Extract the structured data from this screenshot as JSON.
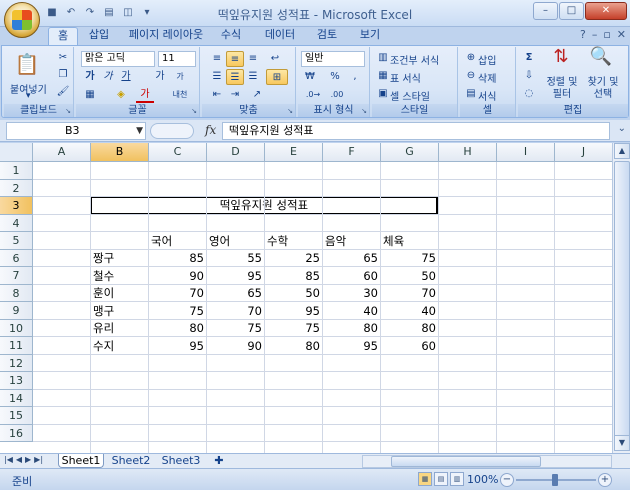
{
  "window": {
    "title": "떡잎유지원 성적표 - Microsoft Excel"
  },
  "ribbon": {
    "tabs": [
      "홈",
      "삽입",
      "페이지 레이아웃",
      "수식",
      "데이터",
      "검토",
      "보기"
    ],
    "active_tab": "홈",
    "clipboard": {
      "paste": "붙여넣기",
      "label": "클립보드"
    },
    "font": {
      "name": "맑은 고딕",
      "size": "11",
      "label": "글꼴",
      "bold": "가",
      "italic": "가",
      "underline": "가",
      "grow": "가",
      "shrink": "가",
      "color_letter": "가",
      "phonetic": "내천"
    },
    "alignment": {
      "label": "맞춤"
    },
    "number": {
      "format": "일반",
      "currency": "₩",
      "percent": "%",
      "comma": ",",
      "label": "표시 형식"
    },
    "styles": {
      "conditional": "조건부 서식",
      "table": "표 서식",
      "cell": "셀 스타일",
      "label": "스타일"
    },
    "cells": {
      "insert": "삽입",
      "delete": "삭제",
      "format": "서식",
      "label": "셀"
    },
    "editing": {
      "sum": "Σ",
      "sort": "정렬 및 필터",
      "find": "찾기 및 선택",
      "label": "편집"
    }
  },
  "formula_bar": {
    "name_box": "B3",
    "fx": "fx",
    "value": "떡잎유지원 성적표"
  },
  "sheet": {
    "columns": [
      "A",
      "B",
      "C",
      "D",
      "E",
      "F",
      "G",
      "H",
      "I",
      "J"
    ],
    "rows": [
      "1",
      "2",
      "3",
      "4",
      "5",
      "6",
      "7",
      "8",
      "9",
      "10",
      "11",
      "12",
      "13",
      "14",
      "15",
      "16"
    ],
    "selected_col": "B",
    "selected_row": "3",
    "title": "떡잎유지원 성적표",
    "headers": [
      "국어",
      "영어",
      "수학",
      "음악",
      "체육"
    ],
    "students": [
      {
        "name": "짱구",
        "scores": [
          "85",
          "55",
          "25",
          "65",
          "75"
        ]
      },
      {
        "name": "철수",
        "scores": [
          "90",
          "95",
          "85",
          "60",
          "50"
        ]
      },
      {
        "name": "훈이",
        "scores": [
          "70",
          "65",
          "50",
          "30",
          "70"
        ]
      },
      {
        "name": "맹구",
        "scores": [
          "75",
          "70",
          "95",
          "40",
          "40"
        ]
      },
      {
        "name": "유리",
        "scores": [
          "80",
          "75",
          "75",
          "80",
          "80"
        ]
      },
      {
        "name": "수지",
        "scores": [
          "95",
          "90",
          "80",
          "95",
          "60"
        ]
      }
    ]
  },
  "sheet_tabs": [
    "Sheet1",
    "Sheet2",
    "Sheet3"
  ],
  "status": {
    "mode": "준비",
    "zoom": "100%"
  }
}
